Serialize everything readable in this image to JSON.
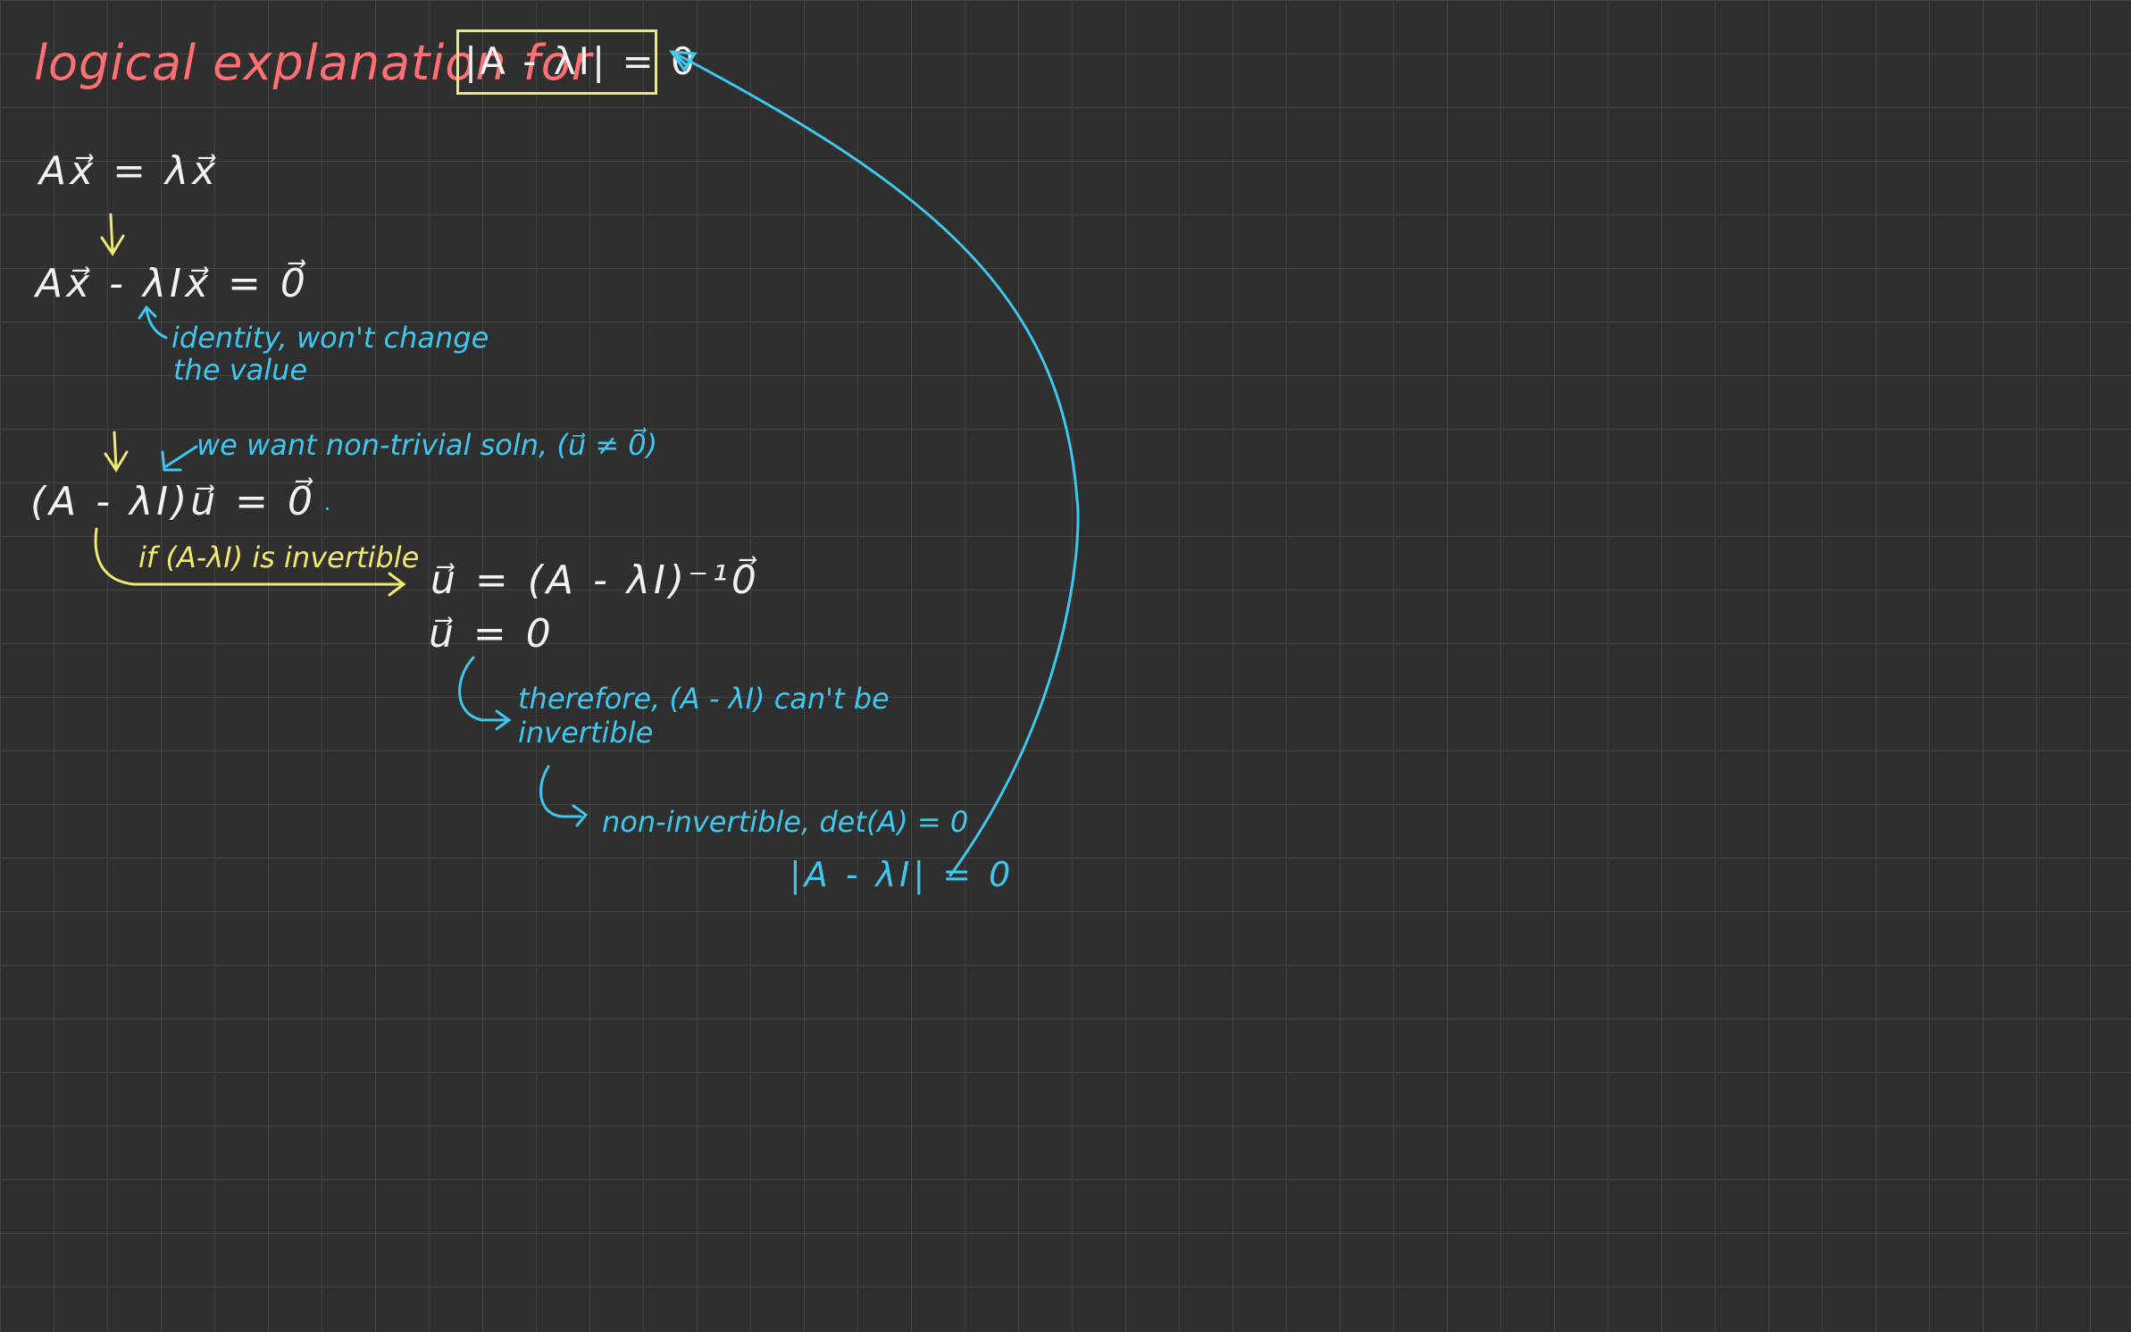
{
  "colors": {
    "canvas_background": "#2f2f2f",
    "grid_line": "#444444",
    "title_pink": "#ff6f73",
    "ink_white": "#f2f2f2",
    "ink_yellow": "#f2ea70",
    "ink_cyan": "#3fc7ee"
  },
  "title": {
    "text": "logical explanation for",
    "boxed_equation": "|A - λI| = 0"
  },
  "equations": {
    "eigen_definition": "Ax⃗ = λx⃗",
    "subtract_step": "Ax⃗ - λIx⃗ = 0⃗",
    "factored": "(A - λI)u⃗ = 0⃗",
    "inverse_solution": "u⃗ = (A - λI)⁻¹0⃗",
    "trivial_result": "u⃗ = 0"
  },
  "notes": {
    "identity_note_line1": "identity, won't change",
    "identity_note_line2": "the value",
    "nontrivial_note": "we want non-trivial soln, (u⃗ ≠ 0⃗)",
    "invertible_condition": "if (A-λI) is invertible",
    "therefore_line1": "therefore, (A - λI) can't be",
    "therefore_line2": "invertible",
    "noninvertible_line": "non-invertible,   det(A) = 0",
    "final_determinant": "|A - λI| = 0"
  },
  "icons": {
    "down_arrow": "down-arrow-icon",
    "curved_arrow": "curved-arrow-icon",
    "return_arrow": "return-arrow-icon"
  }
}
